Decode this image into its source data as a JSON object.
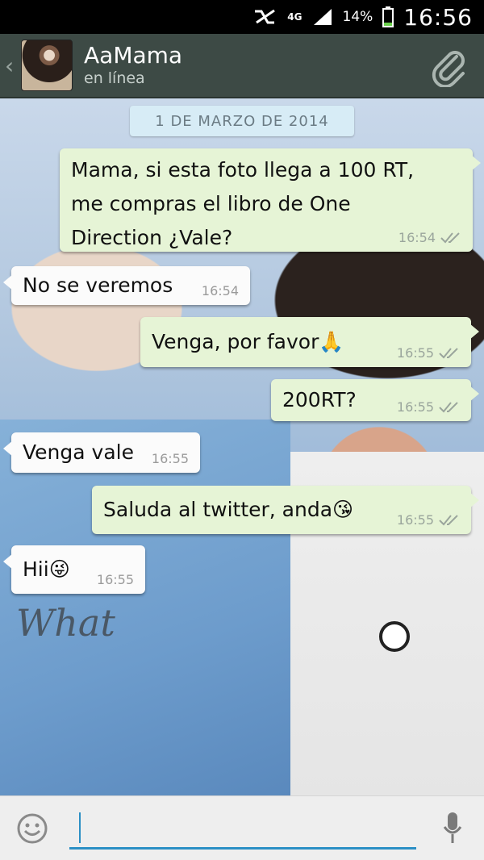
{
  "status_bar": {
    "network": "4G",
    "battery": "14%",
    "time": "16:56"
  },
  "header": {
    "contact_name": "AaMama",
    "contact_status": "en línea"
  },
  "chat": {
    "date_label": "1 DE MARZO DE 2014",
    "messages": [
      {
        "direction": "out",
        "text_lines": [
          "Mama, si esta foto llega a 100 RT,",
          "me compras el libro de One",
          "Direction ¿Vale?"
        ],
        "time": "16:54"
      },
      {
        "direction": "in",
        "text": "No se veremos",
        "time": "16:54"
      },
      {
        "direction": "out",
        "text": "Venga,  por favor🙏",
        "time": "16:55"
      },
      {
        "direction": "out",
        "text": "200RT?",
        "time": "16:55"
      },
      {
        "direction": "in",
        "text": "Venga vale",
        "time": "16:55"
      },
      {
        "direction": "out",
        "text": "Saluda al twitter, anda😘",
        "time": "16:55"
      },
      {
        "direction": "in",
        "text": "Hii😜",
        "time": "16:55"
      }
    ],
    "background_tattoo": "What"
  },
  "input": {
    "value": ""
  },
  "colors": {
    "header_bg": "#3d4a45",
    "outgoing_bubble": "#e6f4d6",
    "incoming_bubble": "#fbfbfb",
    "accent": "#2b8fc5"
  },
  "icons": {
    "back": "chevron-left-icon",
    "attach": "paperclip-icon",
    "emoji": "smiley-icon",
    "mic": "microphone-icon",
    "ticks": "double-check-icon"
  }
}
